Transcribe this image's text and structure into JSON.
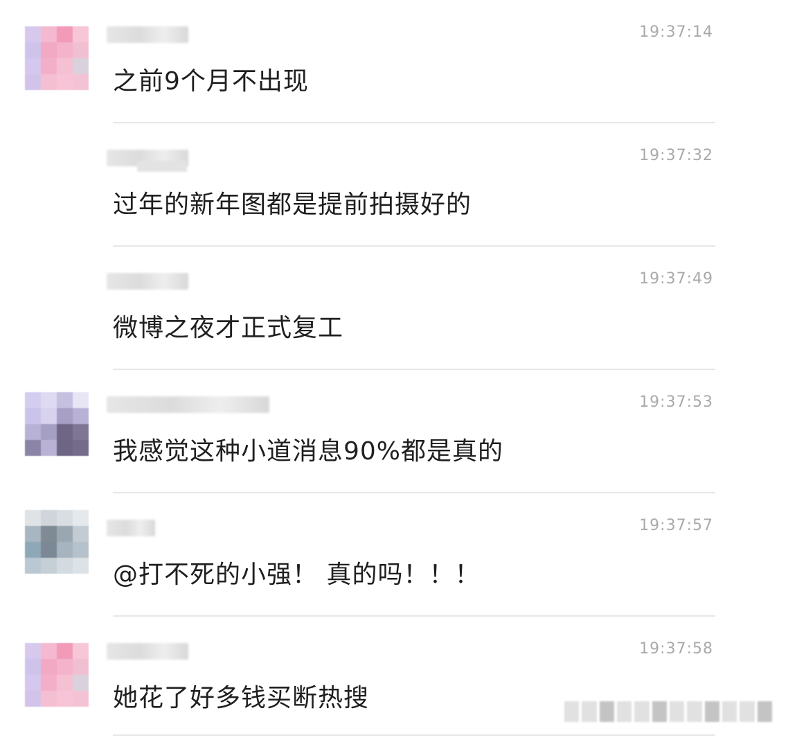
{
  "messages": [
    {
      "time": "19:37:14",
      "text": "之前9个月不出现",
      "avatar": "pink-lavender",
      "has_avatar": true
    },
    {
      "time": "19:37:32",
      "text": "过年的新年图都是提前拍摄好的",
      "avatar": "none",
      "has_avatar": false
    },
    {
      "time": "19:37:49",
      "text": "微博之夜才正式复工",
      "avatar": "none",
      "has_avatar": false
    },
    {
      "time": "19:37:53",
      "text": "我感觉这种小道消息90%都是真的",
      "avatar": "purple-grey",
      "has_avatar": true
    },
    {
      "time": "19:37:57",
      "text": "@打不死的小强！ 真的吗！！！",
      "avatar": "blue-grey",
      "has_avatar": true
    },
    {
      "time": "19:37:58",
      "text": "她花了好多钱买断热搜",
      "avatar": "pink-lavender",
      "has_avatar": true
    }
  ],
  "colors": {
    "text": "#1f1f1f",
    "timestamp": "#a9a9a9",
    "divider": "#e7e7ea",
    "background": "#ffffff"
  }
}
